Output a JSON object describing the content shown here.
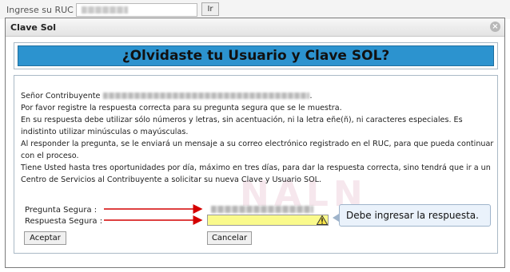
{
  "top": {
    "ruc_label": "Ingrese su RUC :",
    "ir_label": "Ir"
  },
  "dialog": {
    "title": "Clave Sol",
    "banner": "¿Olvidaste tu Usuario y Clave SOL?",
    "intro": "Señor Contribuyente",
    "line1": "Por favor registre la respuesta correcta para su pregunta segura que se le muestra.",
    "line2": "En su respuesta debe utilizar sólo números y letras, sin acentuación, ni la letra eñe(ñ), ni caracteres especiales. Es indistinto utilizar minúsculas o mayúsculas.",
    "line3": "Al responder la pregunta, se le enviará un mensaje a su correo electrónico registrado en el RUC, para que pueda continuar con el proceso.",
    "line4": "Tiene Usted hasta tres oportunidades por día, máximo en tres días, para dar la respuesta correcta, sino tendrá que ir a un Centro de Servicios al Contribuyente a solicitar su nueva Clave y Usuario SOL.",
    "question_label": "Pregunta Segura :",
    "answer_label": "Respuesta Segura :",
    "tooltip": "Debe ingresar la respuesta.",
    "accept": "Aceptar",
    "cancel": "Cancelar",
    "watermark": "NALN"
  },
  "colors": {
    "banner": "#2c93cf",
    "answer_bg": "#fafa8c",
    "arrow": "#d40000",
    "tooltip_bg": "#eaf2fb"
  },
  "icons": {
    "close": "close-icon",
    "warning": "warning-icon"
  }
}
